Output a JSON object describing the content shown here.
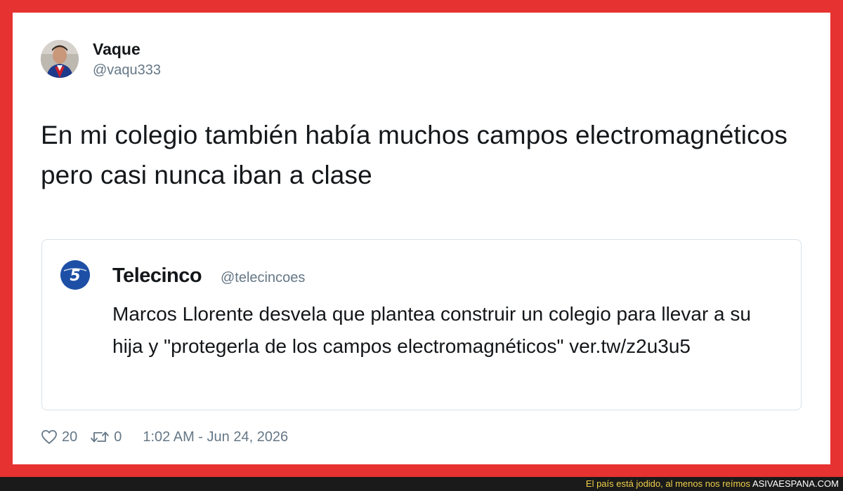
{
  "tweet": {
    "author": {
      "name": "Vaque",
      "handle": "@vaqu333"
    },
    "text": "En mi colegio también había muchos campos electromagnéticos pero casi nunca iban a clase",
    "quoted": {
      "author": {
        "name": "Telecinco",
        "handle": "@telecincoes",
        "avatar_glyph": "5"
      },
      "text": "Marcos Llorente desvela que plantea construir un colegio para llevar a su hija y \"protegerla de los campos electromagnéticos\" ver.tw/z2u3u5"
    },
    "stats": {
      "likes": "20",
      "retweets": "0",
      "timestamp": "1:02 AM - Jun 24, 2026"
    }
  },
  "footer": {
    "tagline": "El país está jodido, al menos nos reímos",
    "brand": "ASIVAESPANA.COM"
  },
  "icons": {
    "like": "heart-icon",
    "retweet": "retweet-icon"
  },
  "colors": {
    "frame": "#e63230",
    "text": "#14171a",
    "muted": "#657786",
    "quote_border": "#d9e1e8",
    "telecinco_blue": "#1d4fa6",
    "footer_bg": "#1a1a1a",
    "footer_tagline": "#f0d04a"
  }
}
